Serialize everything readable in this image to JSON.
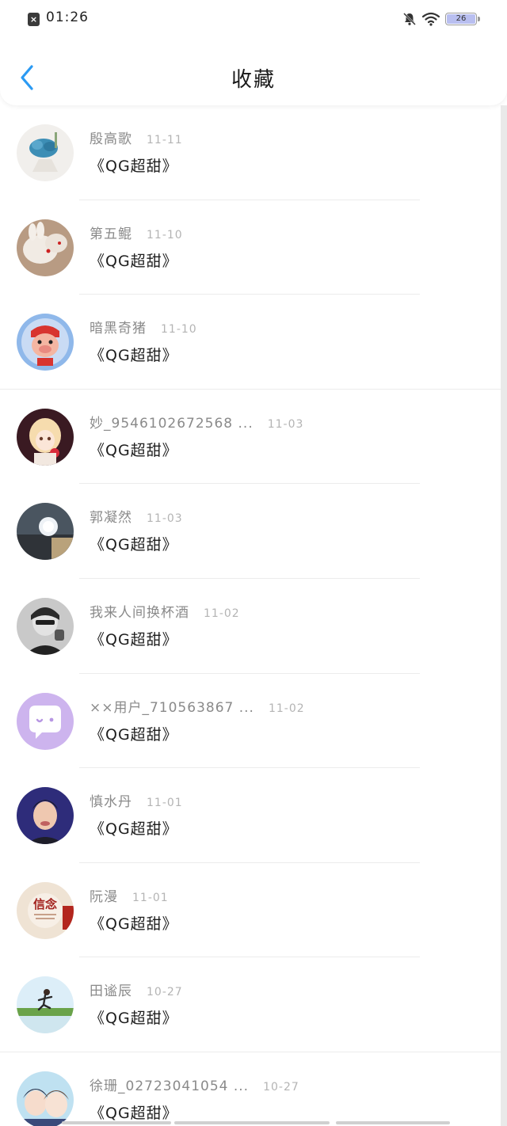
{
  "status_bar": {
    "time": "01:26",
    "battery_level": "26",
    "notif_symbol": "×"
  },
  "header": {
    "title": "收藏"
  },
  "items": [
    {
      "username": "殷高歌",
      "date": "11-11",
      "title": "《QG超甜》"
    },
    {
      "username": "第五鲲",
      "date": "11-10",
      "title": "《QG超甜》"
    },
    {
      "username": "暗黑奇猪",
      "date": "11-10",
      "title": "《QG超甜》"
    },
    {
      "username": "妙_9546102672568 ...",
      "date": "11-03",
      "title": "《QG超甜》"
    },
    {
      "username": "郭凝然",
      "date": "11-03",
      "title": "《QG超甜》"
    },
    {
      "username": "我来人间换杯酒",
      "date": "11-02",
      "title": "《QG超甜》"
    },
    {
      "username": "××用户_710563867 ...",
      "date": "11-02",
      "title": "《QG超甜》"
    },
    {
      "username": "慎水丹",
      "date": "11-01",
      "title": "《QG超甜》"
    },
    {
      "username": "阮漫",
      "date": "11-01",
      "title": "《QG超甜》"
    },
    {
      "username": "田谧辰",
      "date": "10-27",
      "title": "《QG超甜》"
    },
    {
      "username": "徐珊_02723041054 ...",
      "date": "10-27",
      "title": "《QG超甜》"
    }
  ],
  "avatar_badge_text": "信念",
  "colors": {
    "accent": "#2b9af3",
    "username": "#8a8a8a",
    "date": "#b4b4b4"
  }
}
